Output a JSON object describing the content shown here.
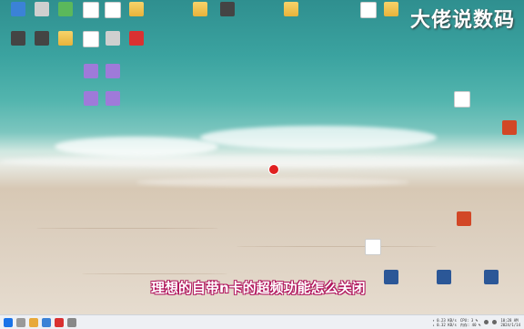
{
  "watermark": "大佬说数码",
  "subtitle": "理想的自带n卡的超频功能怎么关闭",
  "desktop_icons": [
    {
      "label": "",
      "glyph": "g-blue",
      "pos": "i1"
    },
    {
      "label": "",
      "glyph": "g-gray",
      "pos": "i2"
    },
    {
      "label": "",
      "glyph": "g-green",
      "pos": "i3"
    },
    {
      "label": "",
      "glyph": "g-doc",
      "pos": "i4"
    },
    {
      "label": "",
      "glyph": "g-doc",
      "pos": "i5"
    },
    {
      "label": "",
      "glyph": "g-folder",
      "pos": "i6"
    },
    {
      "label": "",
      "glyph": "g-folder",
      "pos": "i7"
    },
    {
      "label": "",
      "glyph": "g-app",
      "pos": "i8"
    },
    {
      "label": "",
      "glyph": "g-folder",
      "pos": "i9"
    },
    {
      "label": "",
      "glyph": "g-doc",
      "pos": "i10"
    },
    {
      "label": "",
      "glyph": "g-folder",
      "pos": "i11"
    },
    {
      "label": "",
      "glyph": "g-app",
      "pos": "i12"
    },
    {
      "label": "",
      "glyph": "g-app",
      "pos": "i13"
    },
    {
      "label": "",
      "glyph": "g-folder",
      "pos": "i14"
    },
    {
      "label": "",
      "glyph": "g-doc",
      "pos": "i15"
    },
    {
      "label": "",
      "glyph": "g-gray",
      "pos": "i16"
    },
    {
      "label": "",
      "glyph": "g-red",
      "pos": "i17"
    },
    {
      "label": "",
      "glyph": "g-purple",
      "pos": "i18"
    },
    {
      "label": "",
      "glyph": "g-purple",
      "pos": "i19"
    },
    {
      "label": "",
      "glyph": "g-purple",
      "pos": "i20"
    },
    {
      "label": "",
      "glyph": "g-purple",
      "pos": "i21"
    },
    {
      "label": "",
      "glyph": "g-ppt",
      "pos": "i22"
    },
    {
      "label": "",
      "glyph": "g-doc",
      "pos": "i23"
    },
    {
      "label": "",
      "glyph": "g-ppt",
      "pos": "i24"
    },
    {
      "label": "",
      "glyph": "g-word",
      "pos": "i25"
    },
    {
      "label": "",
      "glyph": "g-word",
      "pos": "i26"
    },
    {
      "label": "",
      "glyph": "g-word",
      "pos": "i27"
    },
    {
      "label": "",
      "glyph": "g-doc",
      "pos": "i28"
    }
  ],
  "taskbar": {
    "net_up": "↑ 0.23 KB/s",
    "net_down": "↓ 0.32 KB/s",
    "cpu": "CPU: 3 %",
    "mem": "内存: 40 %",
    "time": "10:28 AM",
    "date": "2024/1/14"
  },
  "colors": {
    "subtitle_outline": "#b0155c",
    "pointer": "#e02020"
  }
}
